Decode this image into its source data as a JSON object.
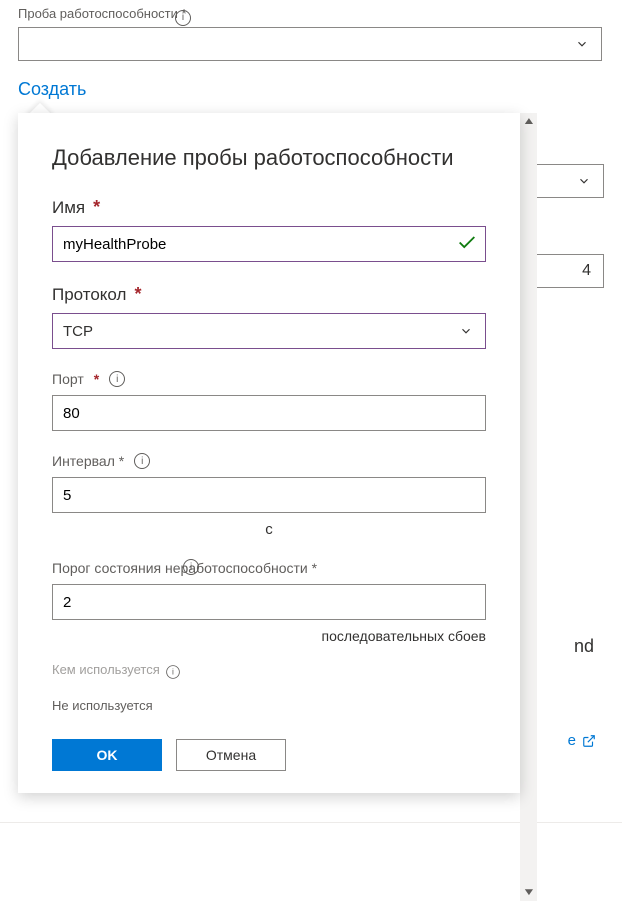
{
  "background": {
    "healthProbeLabel": "Проба работоспособности *",
    "createLink": "Создать",
    "numericValue": "4",
    "partialRightText": "nd",
    "partialLinkText": "e"
  },
  "popup": {
    "title": "Добавление пробы работоспособности",
    "name": {
      "label": "Имя",
      "value": "myHealthProbe"
    },
    "protocol": {
      "label": "Протокол",
      "value": "TCP"
    },
    "port": {
      "label": "Порт",
      "value": "80"
    },
    "interval": {
      "label": "Интервал *",
      "value": "5",
      "unit": "с"
    },
    "threshold": {
      "label": "Порог состояния неработоспособности *",
      "value": "2",
      "suffix": "последовательных сбоев"
    },
    "usedBy": {
      "label": "Кем используется",
      "value": "Не используется"
    },
    "buttons": {
      "ok": "OK",
      "cancel": "Отмена"
    }
  }
}
